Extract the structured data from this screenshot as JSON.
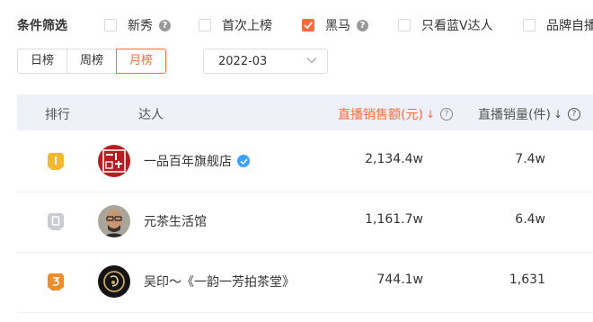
{
  "filters": {
    "title": "条件筛选",
    "options": [
      {
        "label": "新秀",
        "checked": false,
        "has_help": true
      },
      {
        "label": "首次上榜",
        "checked": false,
        "has_help": false
      },
      {
        "label": "黑马",
        "checked": true,
        "has_help": true
      },
      {
        "label": "只看蓝V达人",
        "checked": false,
        "has_help": false
      },
      {
        "label": "品牌自播",
        "checked": false,
        "has_help": false
      }
    ]
  },
  "period": {
    "tabs": [
      "日榜",
      "周榜",
      "月榜"
    ],
    "active": "月榜",
    "date": "2022-03"
  },
  "table": {
    "columns": {
      "rank": "排行",
      "creator": "达人",
      "sales_amount": "直播销售额(元)",
      "sales_qty": "直播销量(件)"
    },
    "sort_arrow": "↓",
    "help_glyph": "?",
    "rows": [
      {
        "rank": 1,
        "name": "一品百年旗舰店",
        "verified": true,
        "amount": "2,134.4w",
        "qty": "7.4w"
      },
      {
        "rank": 2,
        "name": "元茶生活馆",
        "verified": false,
        "amount": "1,161.7w",
        "qty": "6.4w"
      },
      {
        "rank": 3,
        "name": "吴印～《一韵一芳拍茶堂》",
        "verified": false,
        "amount": "744.1w",
        "qty": "1,631"
      }
    ]
  },
  "colors": {
    "accent": "#ff6a3d",
    "header_bg": "#eef1f7",
    "gold": "#f5b82e",
    "silver": "#c9ccd3",
    "bronze": "#f08c2a",
    "verified": "#3aa1ff"
  }
}
